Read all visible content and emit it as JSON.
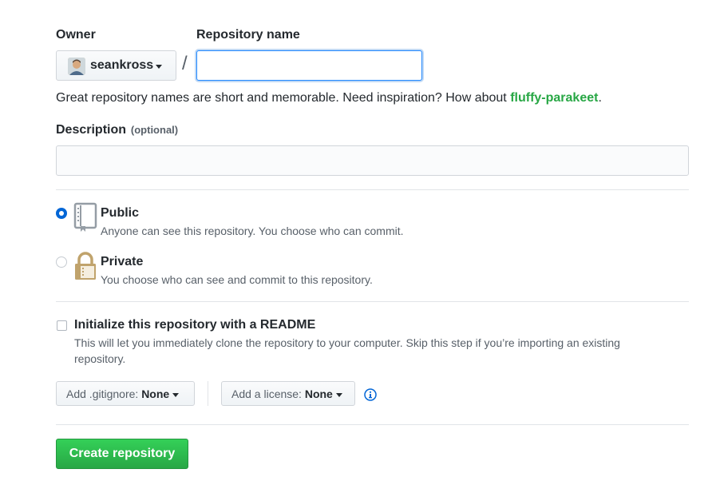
{
  "owner": {
    "label": "Owner",
    "username": "seankross",
    "avatar_icon": "user-avatar"
  },
  "repo_name": {
    "label": "Repository name",
    "separator": "/",
    "value": "",
    "placeholder": ""
  },
  "inspiration": {
    "text": "Great repository names are short and memorable. Need inspiration? How about",
    "suggestion": "fluffy-parakeet",
    "suffix": "."
  },
  "description": {
    "label": "Description",
    "optional": "(optional)",
    "value": ""
  },
  "visibility": {
    "selected": "public",
    "public": {
      "title": "Public",
      "note": "Anyone can see this repository. You choose who can commit.",
      "icon": "repo-book-icon"
    },
    "private": {
      "title": "Private",
      "note": "You choose who can see and commit to this repository.",
      "icon": "lock-icon"
    }
  },
  "readme": {
    "checked": false,
    "title": "Initialize this repository with a README",
    "note_line1": "This will let you immediately clone the repository to your computer. Skip this step if you’re importing an existing",
    "note_line2": "repository."
  },
  "gitignore": {
    "prefix": "Add .gitignore:",
    "value": "None"
  },
  "license": {
    "prefix": "Add a license:",
    "value": "None",
    "info_icon": "info-icon"
  },
  "create_button": {
    "label": "Create repository"
  },
  "colors": {
    "accent": "#0366d6",
    "suggestion": "#28a745",
    "primary_button": "#2cbe4e",
    "lock": "#c0a36c"
  }
}
